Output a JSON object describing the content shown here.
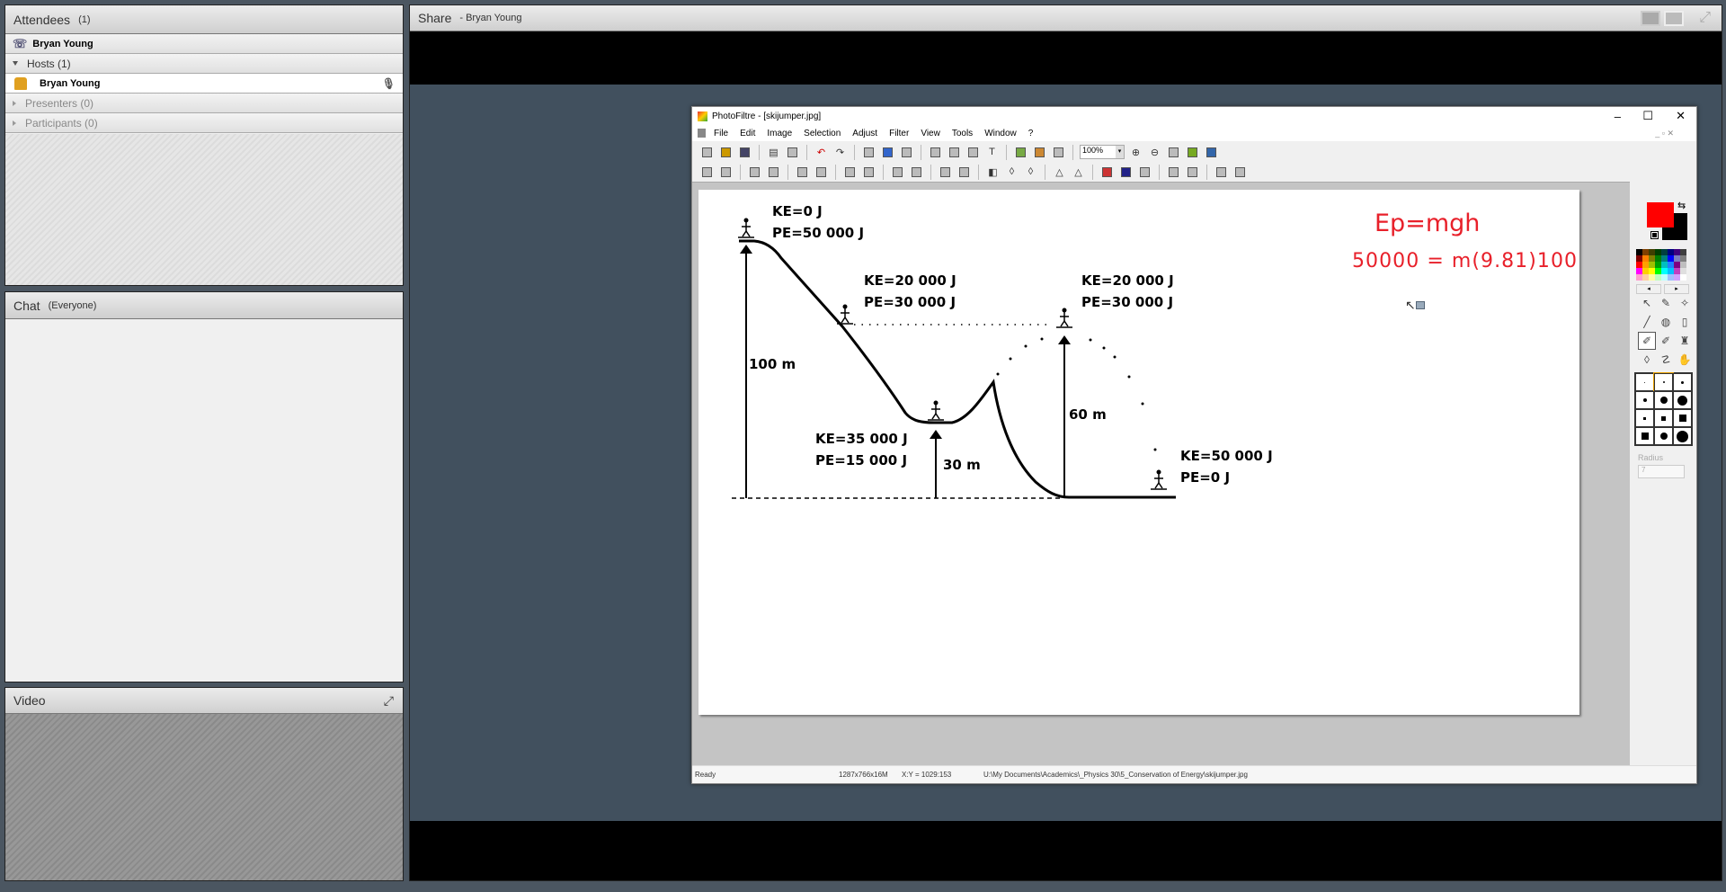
{
  "attendees": {
    "title": "Attendees",
    "count": "(1)",
    "me": "Bryan Young",
    "groups": [
      {
        "label": "Hosts (1)",
        "expanded": true,
        "members": [
          "Bryan Young"
        ]
      },
      {
        "label": "Presenters (0)",
        "expanded": false
      },
      {
        "label": "Participants (0)",
        "expanded": false
      }
    ]
  },
  "chat": {
    "title": "Chat",
    "scope": "(Everyone)"
  },
  "video": {
    "title": "Video"
  },
  "share": {
    "title": "Share",
    "presenter": "- Bryan Young"
  },
  "photofiltre": {
    "window_title": "PhotoFiltre - [skijumper.jpg]",
    "menu": [
      "File",
      "Edit",
      "Image",
      "Selection",
      "Adjust",
      "Filter",
      "View",
      "Tools",
      "Window",
      "?"
    ],
    "zoom": "100%",
    "toolbar1": [
      "new-icon",
      "open-icon",
      "save-icon",
      "|",
      "print-icon",
      "scan-icon",
      "|",
      "undo-icon",
      "redo-icon",
      "|",
      "grayscale-icon",
      "rgb-icon",
      "mask-icon",
      "|",
      "copy-icon",
      "paste-icon",
      "crop-icon",
      "text-icon",
      "|",
      "explorer-icon",
      "effects-icon",
      "window-icon",
      "|",
      "zoom-select",
      "zoom-in-icon",
      "zoom-out-icon",
      "actual-size-icon",
      "fit-icon",
      "fullscreen-icon"
    ],
    "toolbar2": [
      "auto-levels-icon",
      "auto-contrast-icon",
      "|",
      "brightness-minus-icon",
      "brightness-plus-icon",
      "|",
      "contrast-minus-icon",
      "contrast-plus-icon",
      "|",
      "saturation-minus-icon",
      "saturation-plus-icon",
      "|",
      "gamma-minus-icon",
      "gamma-plus-icon",
      "|",
      "grid-icon",
      "grid2-icon",
      "|",
      "dodge-icon",
      "blur-icon",
      "blur-more-icon",
      "|",
      "sharpen-icon",
      "sharpen-more-icon",
      "|",
      "gradient-icon",
      "color-balance-icon",
      "sepia-icon",
      "|",
      "flip-h-icon",
      "flip-v-icon",
      "|",
      "rotate-icon",
      "transform-icon"
    ],
    "status": {
      "state": "Ready",
      "size": "1287x766x16M",
      "coords": "X:Y = 1029:153",
      "path": "U:\\My Documents\\Academics\\_Physics 30\\5_Conservation of Energy\\skijumper.jpg"
    },
    "foreground_color": "#ff0000",
    "background_color": "#000000",
    "palette": [
      "#000000",
      "#7f3f00",
      "#3f3f00",
      "#003f00",
      "#003f3f",
      "#00007f",
      "#3f007f",
      "#3f3f3f",
      "#7f0000",
      "#ff7f00",
      "#7f7f00",
      "#007f00",
      "#007f7f",
      "#0000ff",
      "#7f7fbf",
      "#7f7f7f",
      "#ff0000",
      "#ffa000",
      "#a0c000",
      "#00a000",
      "#00c0c0",
      "#2080ff",
      "#800080",
      "#bfbfbf",
      "#ff00ff",
      "#ffd000",
      "#ffff00",
      "#00ff00",
      "#00ffff",
      "#00c0ff",
      "#c040c0",
      "#dfdfdf",
      "#ff9fcf",
      "#ffd0a0",
      "#ffffa0",
      "#c0ffc0",
      "#c0ffff",
      "#a0c0ff",
      "#d0a0ff",
      "#ffffff"
    ],
    "tools": [
      "select-icon",
      "eyedropper-icon",
      "magic-wand-icon",
      "line-icon",
      "fill-icon",
      "spray-icon",
      "brush-icon",
      "advanced-brush-icon",
      "stamp-icon",
      "blur-drop-icon",
      "smudge-icon",
      "hand-icon"
    ],
    "radius_label": "Radius",
    "radius_value": "7"
  },
  "image": {
    "labels": {
      "top_ke": "KE=0 J",
      "top_pe": "PE=50 000 J",
      "slope_ke": "KE=20 000 J",
      "slope_pe": "PE=30 000 J",
      "jump_ke": "KE=20 000 J",
      "jump_pe": "PE=30 000 J",
      "valley_ke": "KE=35 000 J",
      "valley_pe": "PE=15 000 J",
      "end_ke": "KE=50 000 J",
      "end_pe": "PE=0 J",
      "h100": "100 m",
      "h30": "30 m",
      "h60": "60 m"
    },
    "annotation_line1": "Ep=mgh",
    "annotation_line2": "50000 = m(9.81)100",
    "annotation_color": "#e8202a"
  }
}
